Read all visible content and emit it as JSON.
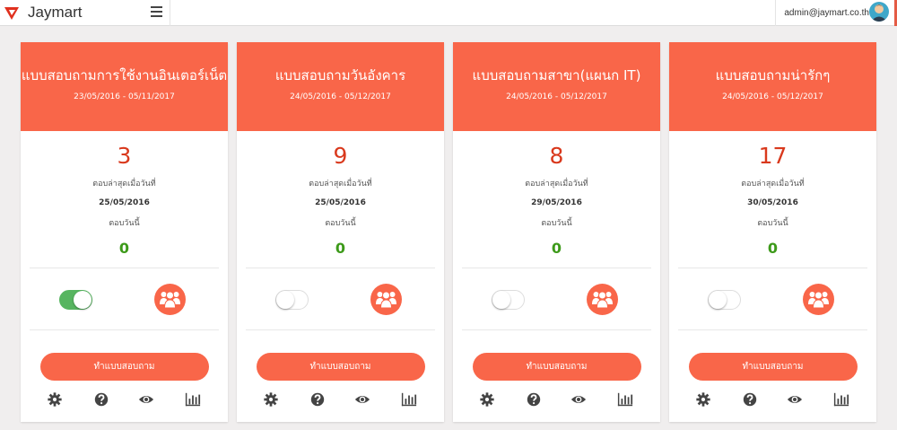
{
  "app": {
    "brand": "Jaymart",
    "user_email": "admin@jaymart.co.th",
    "accent_color": "#f96649",
    "icons": {
      "logo": "jaymart-logo-icon",
      "menu": "hamburger-icon",
      "avatar": "user-avatar-icon",
      "group": "users-group-icon",
      "settings": "gear-icon",
      "help": "question-circle-icon",
      "view": "eye-icon",
      "stats": "bar-chart-icon"
    }
  },
  "labels": {
    "last_answered": "ตอบล่าสุดเมื่อวันที่",
    "answered_today": "ตอบวันนี้",
    "take_survey": "ทำแบบสอบถาม"
  },
  "cards": [
    {
      "title": "แบบสอบถามการใช้งานอินเตอร์เน็ต",
      "dates": "23/05/2016 - 05/11/2017",
      "count": "3",
      "last_date": "25/05/2016",
      "today": "0",
      "active": true
    },
    {
      "title": "แบบสอบถามวันอังคาร",
      "dates": "24/05/2016 - 05/12/2017",
      "count": "9",
      "last_date": "25/05/2016",
      "today": "0",
      "active": false
    },
    {
      "title": "แบบสอบถามสาขา(แผนก IT)",
      "dates": "24/05/2016 - 05/12/2017",
      "count": "8",
      "last_date": "29/05/2016",
      "today": "0",
      "active": false
    },
    {
      "title": "แบบสอบถามน่ารักๆ",
      "dates": "24/05/2016 - 05/12/2017",
      "count": "17",
      "last_date": "30/05/2016",
      "today": "0",
      "active": false
    }
  ]
}
